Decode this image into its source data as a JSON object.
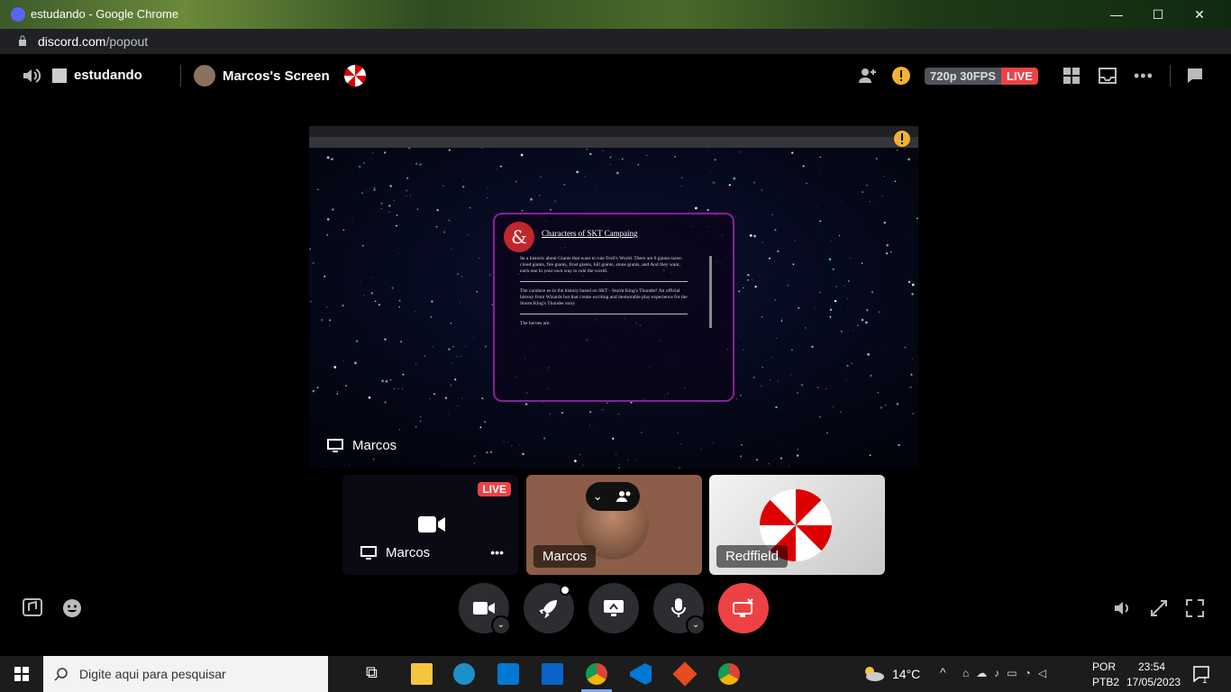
{
  "browser": {
    "window_title": "estudando - Google Chrome",
    "url_host": "discord.com",
    "url_path": "/popout"
  },
  "header": {
    "channel_name": "estudando",
    "stream_title": "Marcos's Screen",
    "quality": "720p 30FPS",
    "live_badge": "LIVE"
  },
  "stage": {
    "presenter_label": "Marcos",
    "card_title": "Characters of SKT Campaing",
    "card_para1": "Its a historic about Giants that want to rule Toril's World. There are 6 giants races: cloud giants, fire giants, frost giants, hill giants, stone giants, and And they want, each one in your own way to rule the world.",
    "card_para2": "The conduce us in the history based on SKT - Storm King's Thunder! An official history from Wizards but that create exciting and memorable play experience for the Storm King's Thunder story",
    "card_para3": "The heroes are:"
  },
  "tiles": [
    {
      "label": "Marcos",
      "live": "LIVE"
    },
    {
      "label": "Marcos"
    },
    {
      "label": "Redffield"
    }
  ],
  "taskbar": {
    "search_placeholder": "Digite aqui para pesquisar",
    "weather": "14°C",
    "lang1": "POR",
    "lang2": "PTB2",
    "time": "23:54",
    "date": "17/05/2023",
    "notif_count": "1"
  },
  "colors": {
    "discord_blue": "#5865f2",
    "live_red": "#ed4245",
    "end_call_red": "#ed4245",
    "control_bg": "#2b2d31"
  }
}
